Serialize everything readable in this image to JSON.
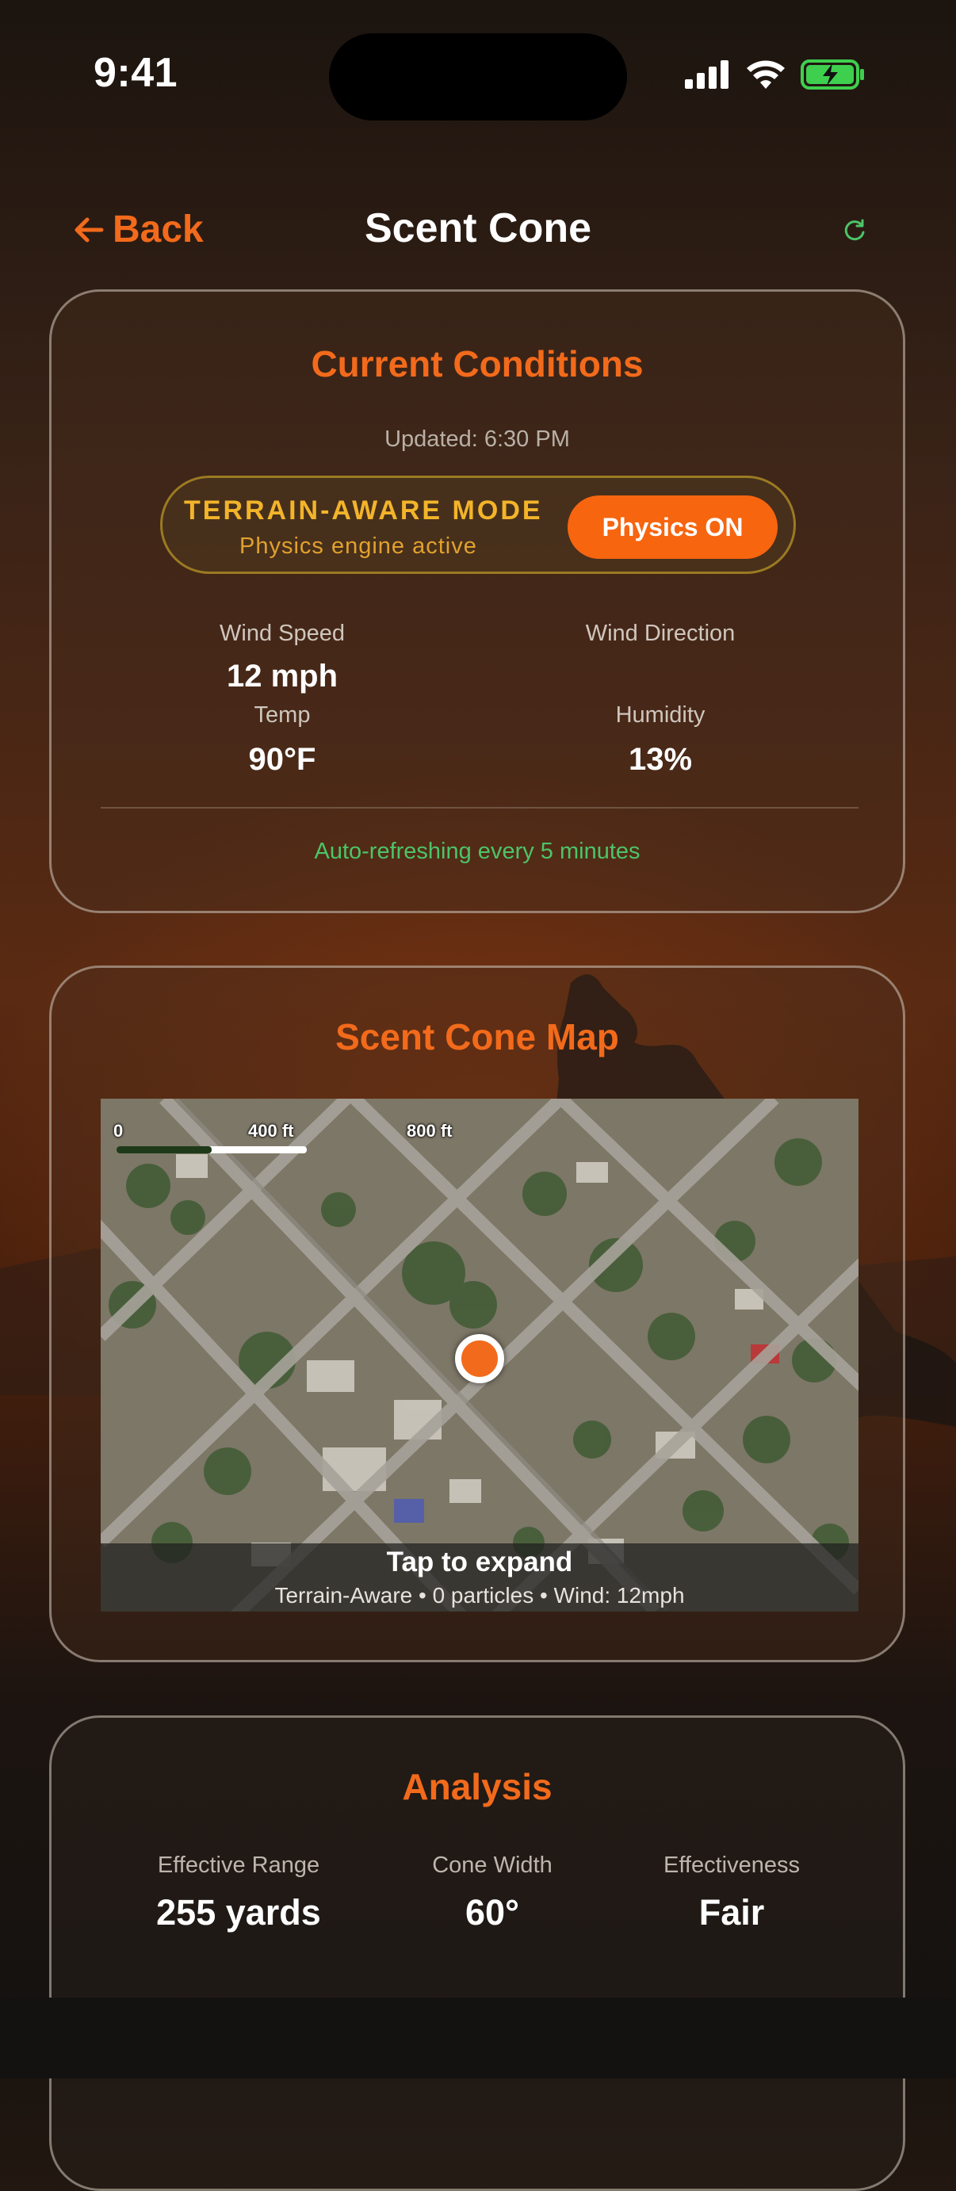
{
  "status_bar": {
    "time": "9:41"
  },
  "nav": {
    "back_label": "Back",
    "title": "Scent Cone"
  },
  "conditions": {
    "title": "Current Conditions",
    "updated": "Updated: 6:30 PM",
    "terrain_mode_title": "TERRAIN-AWARE MODE",
    "terrain_mode_subtitle": "Physics engine active",
    "physics_button_label": "Physics ON",
    "wind_speed_label": "Wind Speed",
    "wind_speed_value": "12 mph",
    "wind_direction_label": "Wind Direction",
    "temp_label": "Temp",
    "temp_value": "90°F",
    "humidity_label": "Humidity",
    "humidity_value": "13%",
    "auto_refresh": "Auto-refreshing every 5 minutes"
  },
  "map_card": {
    "title": "Scent Cone Map",
    "scale_labels": [
      "0",
      "400 ft",
      "800 ft"
    ],
    "caption_title": "Tap to expand",
    "caption_subtitle": "Terrain-Aware • 0 particles • Wind: 12mph"
  },
  "analysis": {
    "title": "Analysis",
    "stats": [
      {
        "label": "Effective Range",
        "value": "255 yards"
      },
      {
        "label": "Cone Width",
        "value": "60°"
      },
      {
        "label": "Effectiveness",
        "value": "Fair"
      }
    ]
  },
  "colors": {
    "accent": "#f26a1b",
    "terrain_gold": "#f3b42a",
    "refresh_green": "#4cc468",
    "battery_green": "#3fcf4f"
  }
}
